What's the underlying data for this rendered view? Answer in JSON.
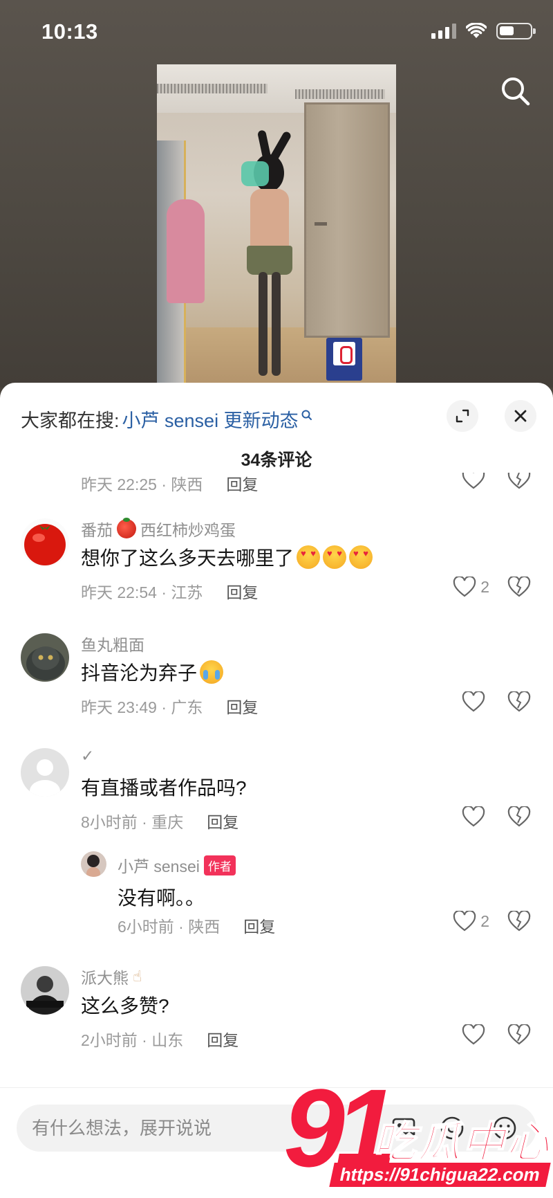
{
  "status_bar": {
    "time": "10:13"
  },
  "sheet": {
    "search_prefix": "大家都在搜:",
    "search_query": "小芦 sensei 更新动态",
    "comment_count": "34条评论"
  },
  "partial_comment": {
    "meta_time": "昨天 22:25 · 陕西",
    "reply": "回复"
  },
  "comments": [
    {
      "name": "番茄🍅西红柿炒鸡蛋",
      "name_before": "番茄",
      "name_after": "西红柿炒鸡蛋",
      "text": "想你了这么多天去哪里了",
      "emoji": "heart-eyes x3",
      "time": "昨天 22:54 · 江苏",
      "reply": "回复",
      "likes": "2"
    },
    {
      "name": "鱼丸粗面",
      "text": "抖音沦为弃子",
      "emoji": "crying-face",
      "time": "昨天 23:49 · 广东",
      "reply": "回复",
      "likes": ""
    },
    {
      "name": "✓",
      "text": "有直播或者作品吗?",
      "time": "8小时前 · 重庆",
      "reply": "回复",
      "likes": ""
    },
    {
      "name": "小芦 sensei",
      "author_tag": "作者",
      "text": "没有啊。。",
      "time": "6小时前 · 陕西",
      "reply": "回复",
      "likes": "2"
    },
    {
      "name": "派大熊",
      "name_emoji": "pointing-up-hand",
      "text": "这么多赞?",
      "time": "2小时前 · 山东",
      "reply": "回复",
      "likes": ""
    }
  ],
  "input": {
    "placeholder": "有什么想法，展开说说"
  },
  "watermark": {
    "big": "91",
    "cn": "吃瓜中心",
    "url": "https://91chigua22.com"
  },
  "colors": {
    "link": "#2a5fa3",
    "author_tag": "#f2325a",
    "watermark": "#f21c3e"
  }
}
